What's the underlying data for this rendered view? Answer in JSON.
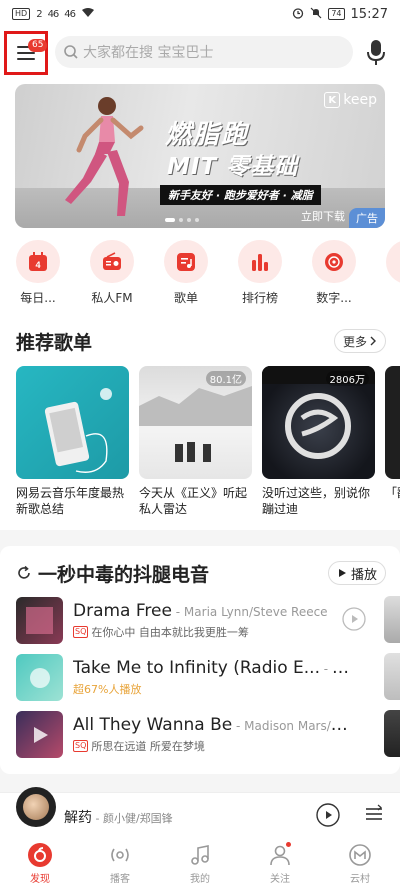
{
  "status_bar": {
    "left_badges": [
      "HD",
      "2",
      "46",
      "46"
    ],
    "battery": "74",
    "time": "15:27"
  },
  "header": {
    "menu_badge": "65",
    "search_placeholder": "大家都在搜 宝宝巴士"
  },
  "banner": {
    "brand": "keep",
    "title_line1": "燃脂跑",
    "title_line2": "MIT 零基础",
    "subtitle": "新手友好 · 跑步爱好者 · 减脂",
    "download_label": "立即下载",
    "ad_label": "广告",
    "colors": {
      "ad_bg": "#5c8fd6"
    }
  },
  "quick_nav": [
    {
      "label": "每日...",
      "icon": "calendar-icon"
    },
    {
      "label": "私人FM",
      "icon": "radio-icon"
    },
    {
      "label": "歌单",
      "icon": "playlist-icon"
    },
    {
      "label": "排行榜",
      "icon": "chart-bars-icon"
    },
    {
      "label": "数字...",
      "icon": "vinyl-icon"
    }
  ],
  "recommended": {
    "title": "推荐歌单",
    "more_label": "更多",
    "playlists": [
      {
        "title": "网易云音乐年度最热新歌总结",
        "count": ""
      },
      {
        "title": "今天从《正义》听起私人雷达",
        "count": "80.1亿"
      },
      {
        "title": "没听过这些，别说你蹦过迪",
        "count": "2806万"
      },
      {
        "title": "「翻」永远",
        "count": ""
      }
    ]
  },
  "song_section": {
    "title": "一秒中毒的抖腿电音",
    "play_label": "播放",
    "songs": [
      {
        "name": "Drama Free",
        "artist": " - Maria Lynn/Steve Reece",
        "badge": "SQ",
        "sub": "在你心中 自由本就比我更胜一筹",
        "hot": ""
      },
      {
        "name": "Take Me to Infinity (Radio E...",
        "artist": " - Con...",
        "badge": "",
        "sub": "",
        "hot": "超67%人播放"
      },
      {
        "name": "All They Wanna Be",
        "artist": " - Madison Mars/Caslin",
        "badge": "SQ",
        "sub": "所思在远道 所爱在梦境",
        "hot": ""
      }
    ]
  },
  "player": {
    "title": "解药",
    "artist": " - 颜小健/郑国锋"
  },
  "bottom_nav": [
    {
      "label": "发现",
      "icon": "discover-icon",
      "active": true
    },
    {
      "label": "播客",
      "icon": "podcast-icon"
    },
    {
      "label": "我的",
      "icon": "music-note-icon"
    },
    {
      "label": "关注",
      "icon": "follow-icon"
    },
    {
      "label": "云村",
      "icon": "cloud-village-icon"
    }
  ],
  "colors": {
    "accent": "#e83a30",
    "highlight_box": "#e01818"
  }
}
